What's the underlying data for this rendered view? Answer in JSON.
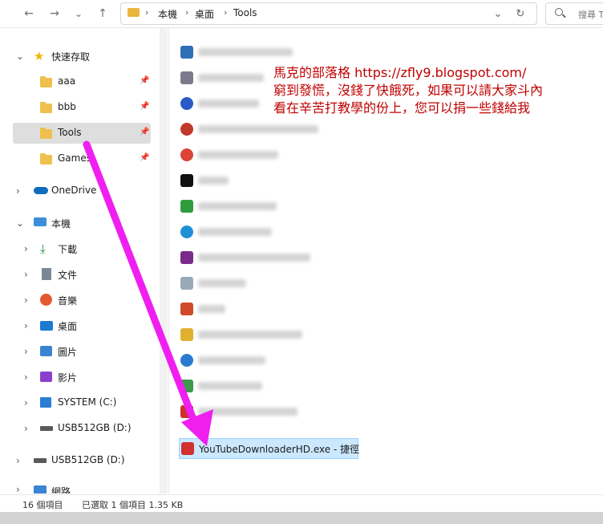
{
  "toolbar": {
    "back_icon": "←",
    "forward_icon": "→",
    "dropdown_icon": "⌄",
    "up_icon": "↑",
    "breadcrumbs": [
      "本機",
      "桌面",
      "Tools"
    ],
    "addr_dropdown_icon": "⌄",
    "refresh_icon": "↻",
    "search_placeholder": "搜尋 To"
  },
  "sidebar": {
    "quick_access": "快速存取",
    "pinned": [
      {
        "label": "aaa"
      },
      {
        "label": "bbb"
      },
      {
        "label": "Tools"
      },
      {
        "label": "Games"
      }
    ],
    "onedrive": "OneDrive",
    "this_pc": "本機",
    "pc_items": [
      "下載",
      "文件",
      "音樂",
      "桌面",
      "圖片",
      "影片",
      "SYSTEM (C:)",
      "USB512GB (D:)"
    ],
    "usb": "USB512GB (D:)",
    "network": "網路"
  },
  "files": {
    "selected_name": "YouTubeDownloaderHD.exe - 捷徑"
  },
  "note": {
    "line1": "馬克的部落格 https://zfly9.blogspot.com/",
    "line2": "窮到發慌，沒錢了快餓死，如果可以請大家斗內",
    "line3": "看在辛苦打教學的份上，您可以捐一些錢給我"
  },
  "status": {
    "count": "16 個項目",
    "selection": "已選取 1 個項目 1.35 KB"
  },
  "colors": {
    "arrow": "#f01ff0",
    "note": "#c00000",
    "selection_bg": "#cce8ff",
    "folder": "#efc04d"
  }
}
